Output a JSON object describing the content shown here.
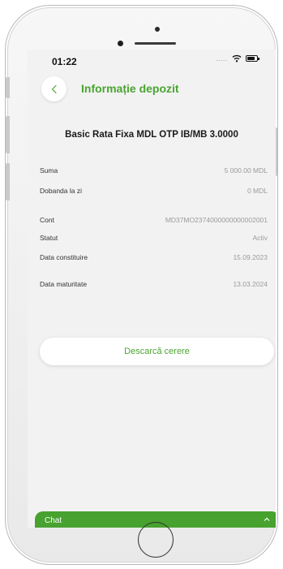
{
  "status_bar": {
    "time": "01:22",
    "signal": "....."
  },
  "header": {
    "title": "Informație depozit",
    "back_icon": "chevron-left-icon"
  },
  "deposit": {
    "name": "Basic Rata Fixa MDL OTP IB/MB 3.0000"
  },
  "info_rows": [
    {
      "label": "Suma",
      "value": "5 000.00 MDL"
    },
    {
      "label": "Dobanda la zi",
      "value": "0 MDL"
    },
    {
      "label": "Cont",
      "value": "MD37MO2374000000000002001"
    },
    {
      "label": "Statut",
      "value": "Activ"
    },
    {
      "label": "Data constituire",
      "value": "15.09.2023"
    },
    {
      "label": "Data maturitate",
      "value": "13.03.2024"
    }
  ],
  "actions": {
    "download_label": "Descarcă cerere"
  },
  "chat": {
    "label": "Chat"
  },
  "colors": {
    "accent": "#4aa431",
    "chat_bar": "#47a22f",
    "screen_bg": "#f2f2f2"
  }
}
